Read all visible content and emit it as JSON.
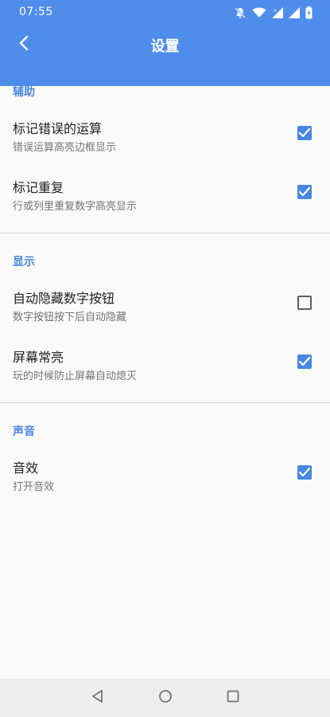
{
  "status_bar": {
    "time": "07:55",
    "icons": [
      "mute-bell-icon",
      "wifi-icon",
      "signal-icon",
      "signal-icon",
      "battery-charging-icon"
    ]
  },
  "toolbar": {
    "title": "设置",
    "back_icon": "back-arrow-icon"
  },
  "sections": [
    {
      "header": "辅助",
      "items": [
        {
          "title": "标记错误的运算",
          "summary": "错误运算高亮边框显示",
          "checked": true
        },
        {
          "title": "标记重复",
          "summary": "行或列里重复数字高亮显示",
          "checked": true
        }
      ]
    },
    {
      "header": "显示",
      "items": [
        {
          "title": "自动隐藏数字按钮",
          "summary": "数字按钮按下后自动隐藏",
          "checked": false
        },
        {
          "title": "屏幕常亮",
          "summary": "玩的时候防止屏幕自动熄灭",
          "checked": true
        }
      ]
    },
    {
      "header": "声音",
      "items": [
        {
          "title": "音效",
          "summary": "打开音效",
          "checked": true
        }
      ]
    }
  ],
  "nav_bar": {
    "buttons": [
      "back-triangle-icon",
      "home-circle-icon",
      "recents-square-icon"
    ]
  },
  "colors": {
    "accent": "#4a86e0",
    "app_bar": "#4f8ded",
    "background": "#fafafa",
    "nav_bar": "#eeeeee"
  }
}
